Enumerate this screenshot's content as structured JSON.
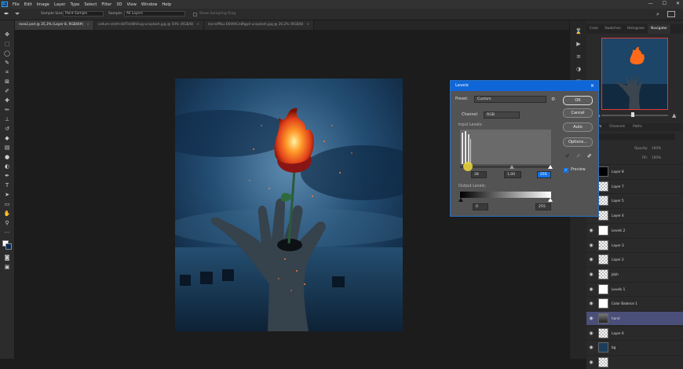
{
  "menu": {
    "app_icon": "Ps",
    "items": [
      "File",
      "Edit",
      "Image",
      "Layer",
      "Type",
      "Select",
      "Filter",
      "3D",
      "View",
      "Window",
      "Help"
    ]
  },
  "window_controls": {
    "minimize": "—",
    "maximize": "☐",
    "close": "✕"
  },
  "options_bar": {
    "sample_size_label": "Sample Size:",
    "sample_size_value": "Point Sample",
    "sample_label": "Sample:",
    "sample_value": "All Layers",
    "show_ring_label": "Show Sampling Ring"
  },
  "tabs": [
    {
      "label": "rose2.psd @ 35,3% (Layer 8, RGB/8#)",
      "close": "×"
    },
    {
      "label": "callum-smith-8dTIs08hOug-unsplash.jpg @ 50% (RGB/8)",
      "close": "×"
    },
    {
      "label": "lea-loffiku-D0IXACn8fgp4-unsplash.jpg @ 20,2% (RGB/8)",
      "close": "×"
    }
  ],
  "navigator_panel": {
    "tabs": [
      "Color",
      "Swatches",
      "Histogram",
      "Navigator"
    ],
    "active_tab": "Navigator"
  },
  "layers_panel": {
    "tabs": [
      "Layers",
      "Channels",
      "Paths"
    ],
    "opacity_label": "Opacity:",
    "opacity_value": "100%",
    "fill_label": "Fill:",
    "fill_value": "100%",
    "layers": [
      {
        "name": "Layer 8",
        "visible": false,
        "selected": false,
        "thumb": "black"
      },
      {
        "name": "Layer 7",
        "visible": false,
        "selected": false,
        "thumb": "checker"
      },
      {
        "name": "Layer 5",
        "visible": false,
        "selected": false,
        "thumb": "checker"
      },
      {
        "name": "Layer 4",
        "visible": false,
        "selected": false,
        "thumb": "checker"
      },
      {
        "name": "Levels 2",
        "visible": true,
        "selected": false,
        "thumb": "adjust"
      },
      {
        "name": "Layer 3",
        "visible": true,
        "selected": false,
        "thumb": "checker"
      },
      {
        "name": "Layer 2",
        "visible": true,
        "selected": false,
        "thumb": "checker"
      },
      {
        "name": "Jsbh",
        "visible": true,
        "selected": false,
        "thumb": "checker"
      },
      {
        "name": "Levels 1",
        "visible": true,
        "selected": false,
        "thumb": "adjust"
      },
      {
        "name": "Color Balance 1",
        "visible": true,
        "selected": false,
        "thumb": "adjust"
      },
      {
        "name": "hand",
        "visible": true,
        "selected": true,
        "thumb": "hand"
      },
      {
        "name": "Layer 6",
        "visible": true,
        "selected": false,
        "thumb": "checker"
      },
      {
        "name": "bg",
        "visible": true,
        "selected": false,
        "thumb": "bg"
      },
      {
        "name": "",
        "visible": true,
        "selected": false,
        "thumb": "checker"
      }
    ]
  },
  "levels_dialog": {
    "title": "Levels",
    "close": "✕",
    "preset_label": "Preset:",
    "preset_value": "Custom",
    "channel_label": "Channel:",
    "channel_value": "RGB",
    "input_levels_label": "Input Levels:",
    "input_black": "28",
    "input_gamma": "1,00",
    "input_white": "255",
    "output_levels_label": "Output Levels:",
    "output_black": "0",
    "output_white": "255",
    "ok_label": "OK",
    "cancel_label": "Cancel",
    "auto_label": "Auto",
    "options_label": "Options...",
    "preview_label": "Preview",
    "preview_checked": true
  },
  "colors": {
    "accent_blue": "#0f66d8",
    "selection": "#4a4f7a",
    "nav_frame": "#e13a3a",
    "fire": "#ff6a1a"
  }
}
